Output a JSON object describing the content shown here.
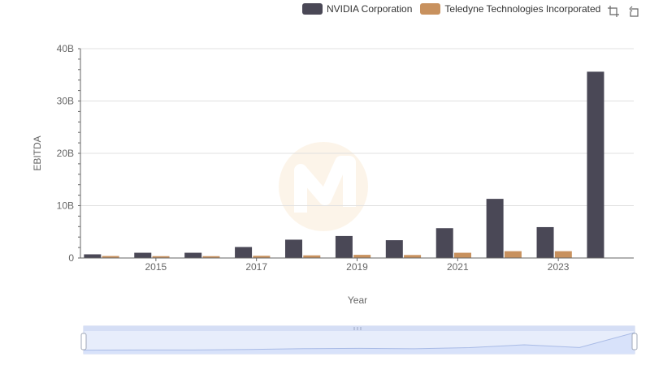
{
  "legend": {
    "items": [
      {
        "label": "NVIDIA Corporation",
        "color": "#4a4856"
      },
      {
        "label": "Teledyne Technologies Incorporated",
        "color": "#c8915e"
      }
    ]
  },
  "toolbar": {
    "zoom_icon": "zoom-crop-icon",
    "restore_icon": "restore-icon"
  },
  "chart_data": {
    "type": "bar",
    "xlabel": "Year",
    "ylabel": "EBITDA",
    "ylim": [
      0,
      40000000000
    ],
    "yticks": [
      0,
      10000000000,
      20000000000,
      30000000000,
      40000000000
    ],
    "ytick_labels": [
      "0",
      "10B",
      "20B",
      "30B",
      "40B"
    ],
    "categories": [
      "2014",
      "2015",
      "2016",
      "2017",
      "2018",
      "2019",
      "2020",
      "2021",
      "2022",
      "2023",
      "2024"
    ],
    "xtick_labels": [
      "2015",
      "2017",
      "2019",
      "2021",
      "2023"
    ],
    "series": [
      {
        "name": "NVIDIA Corporation",
        "color": "#4a4856",
        "values": [
          700000000,
          1000000000,
          1000000000,
          2100000000,
          3500000000,
          4200000000,
          3400000000,
          5700000000,
          11300000000,
          5900000000,
          35600000000
        ]
      },
      {
        "name": "Teledyne Technologies Incorporated",
        "color": "#c8915e",
        "values": [
          380000000,
          350000000,
          350000000,
          420000000,
          500000000,
          600000000,
          570000000,
          1000000000,
          1300000000,
          1300000000,
          0
        ]
      }
    ],
    "grid": true,
    "legend_position": "top-right",
    "zoom_slider": {
      "visible": true
    }
  }
}
